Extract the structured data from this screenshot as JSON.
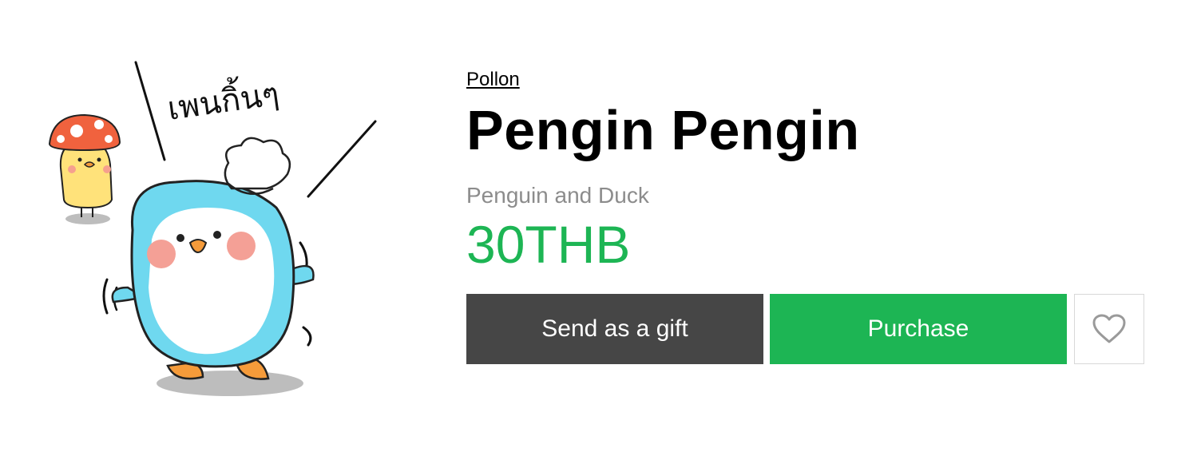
{
  "product": {
    "author": "Pollon",
    "title": "Pengin Pengin",
    "subtitle": "Penguin and Duck",
    "price": "30THB",
    "sticker_caption": "เพนกิ้นๆ"
  },
  "actions": {
    "gift_label": "Send as a gift",
    "purchase_label": "Purchase",
    "favorite_icon": "heart-outline-icon"
  },
  "colors": {
    "price": "#1db554",
    "gift_button_bg": "#464646",
    "purchase_button_bg": "#1db554",
    "subtitle": "#8c8c8c",
    "penguin_body": "#6fd8ef",
    "heart_outline": "#9a9a9a"
  }
}
